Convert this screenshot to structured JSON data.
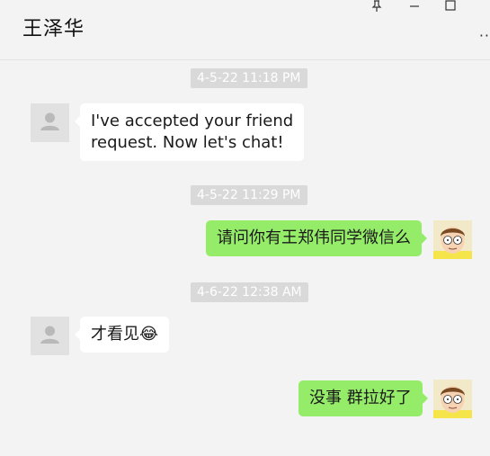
{
  "header": {
    "title": "王泽华",
    "pin_icon": "pin-icon",
    "minimize_icon": "minimize-icon",
    "maximize_icon": "maximize-icon",
    "more_icon": "more-icon",
    "more_glyph": "··"
  },
  "messages": [
    {
      "timestamp": "4-5-22 11:18 PM",
      "direction": "in",
      "text_lines": [
        "I've accepted your friend",
        "request. Now let's chat!"
      ]
    },
    {
      "timestamp": "4-5-22 11:29 PM",
      "direction": "out",
      "text": "请问你有王郑伟同学微信么"
    },
    {
      "timestamp": "4-6-22 12:38 AM",
      "direction": "in",
      "text": "才看见",
      "emoji": "😂"
    },
    {
      "direction": "out",
      "text": "没事 群拉好了"
    }
  ],
  "colors": {
    "outgoing_bubble": "#95ec69",
    "incoming_bubble": "#ffffff",
    "timestamp_bg": "#d9d9d9",
    "background": "#f3f3f3"
  }
}
